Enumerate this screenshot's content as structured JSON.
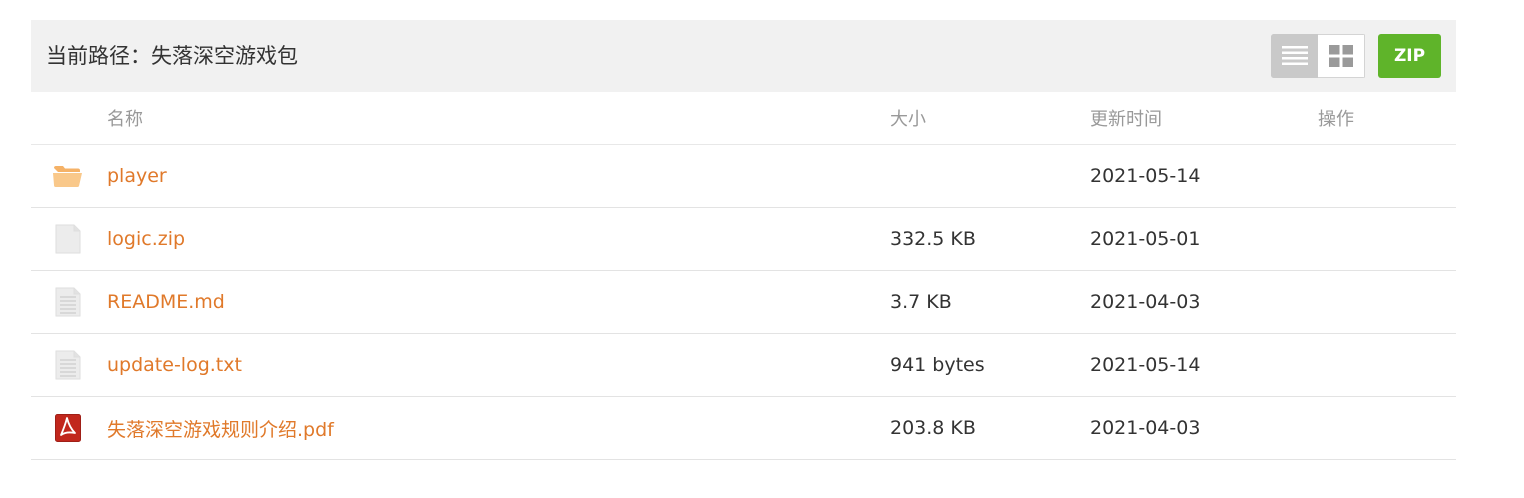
{
  "path": {
    "label": "当前路径：失落深空游戏包"
  },
  "toolbar": {
    "list_view_icon": "list-view-icon",
    "grid_view_icon": "grid-view-icon",
    "zip_label": "ZIP",
    "zip_color": "#5fb42a"
  },
  "columns": {
    "name": "名称",
    "size": "大小",
    "time": "更新时间",
    "ops": "操作"
  },
  "files": [
    {
      "name": "player",
      "size": "",
      "time": "2021-05-14",
      "icon": "folder-icon"
    },
    {
      "name": "logic.zip",
      "size": "332.5 KB",
      "time": "2021-05-01",
      "icon": "blank-file-icon"
    },
    {
      "name": "README.md",
      "size": "3.7 KB",
      "time": "2021-04-03",
      "icon": "text-file-icon"
    },
    {
      "name": "update-log.txt",
      "size": "941 bytes",
      "time": "2021-05-14",
      "icon": "text-file-icon"
    },
    {
      "name": "失落深空游戏规则介绍.pdf",
      "size": "203.8 KB",
      "time": "2021-04-03",
      "icon": "pdf-icon"
    }
  ],
  "colors": {
    "link": "#e0792a",
    "pathbar_bg": "#f1f1f1"
  }
}
